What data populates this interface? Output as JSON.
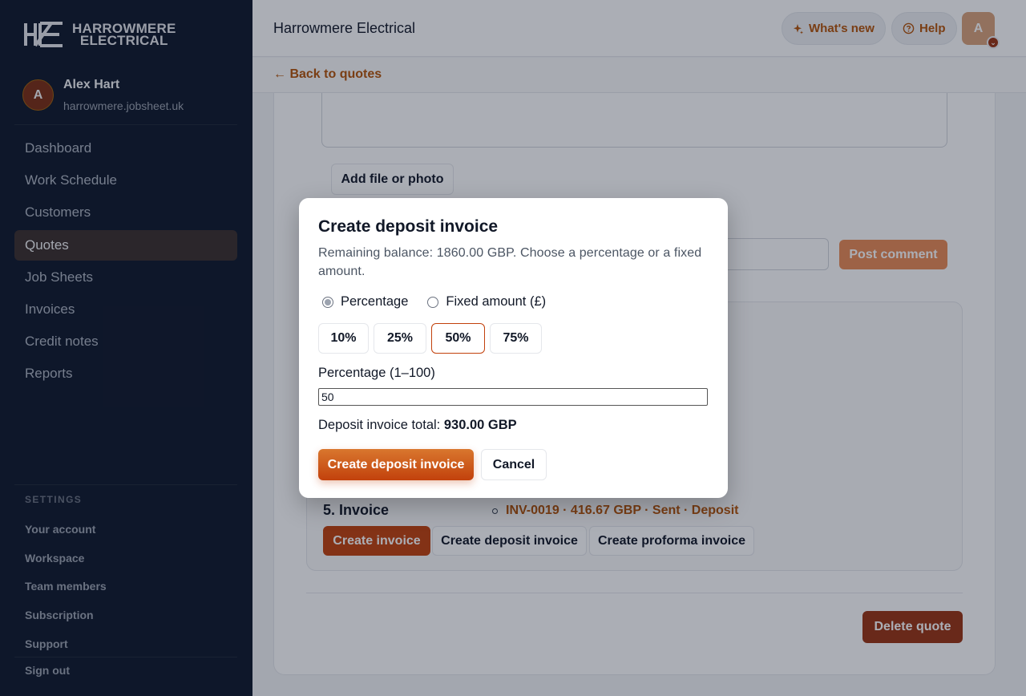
{
  "brand": {
    "line1": "HARROWMERE",
    "line2": "ELECTRICAL"
  },
  "user": {
    "initial": "A",
    "name": "Alex Hart",
    "domain": "harrowmere.jobsheet.uk"
  },
  "nav": [
    {
      "label": "Dashboard"
    },
    {
      "label": "Work Schedule"
    },
    {
      "label": "Customers"
    },
    {
      "label": "Quotes",
      "active": true
    },
    {
      "label": "Job Sheets"
    },
    {
      "label": "Invoices"
    },
    {
      "label": "Credit notes"
    },
    {
      "label": "Reports"
    }
  ],
  "settings": {
    "heading": "SETTINGS",
    "items": [
      "Your account",
      "Workspace",
      "Team members",
      "Subscription",
      "Support"
    ],
    "sign_out": "Sign out"
  },
  "header": {
    "title": "Harrowmere Electrical",
    "whats_new": "What's new",
    "help": "Help",
    "avatar_initial": "A",
    "back_link": "← Back to quotes"
  },
  "content": {
    "add_file": "Add file or photo",
    "post_comment": "Post comment",
    "invoice_section_title": "5. Invoice",
    "invoice_entry": "INV-0019 · 416.67 GBP · Sent · Deposit",
    "create_invoice": "Create invoice",
    "create_deposit_invoice": "Create deposit invoice",
    "create_proforma_invoice": "Create proforma invoice",
    "delete_quote": "Delete quote"
  },
  "modal": {
    "title": "Create deposit invoice",
    "subtitle": "Remaining balance: 1860.00 GBP. Choose a percentage or a fixed amount.",
    "radio_percentage": "Percentage",
    "radio_fixed": "Fixed amount (£)",
    "selected_mode": "percentage",
    "presets": [
      "10%",
      "25%",
      "50%",
      "75%"
    ],
    "selected_preset": "50%",
    "percentage_label": "Percentage (1–100)",
    "percentage_value": "50",
    "total_label": "Deposit invoice total:",
    "total_value": "930.00 GBP",
    "create_button": "Create deposit invoice",
    "cancel_button": "Cancel"
  },
  "colors": {
    "sidebar_bg": "#0f172a",
    "accent": "#c2410c",
    "link": "#b45309"
  }
}
